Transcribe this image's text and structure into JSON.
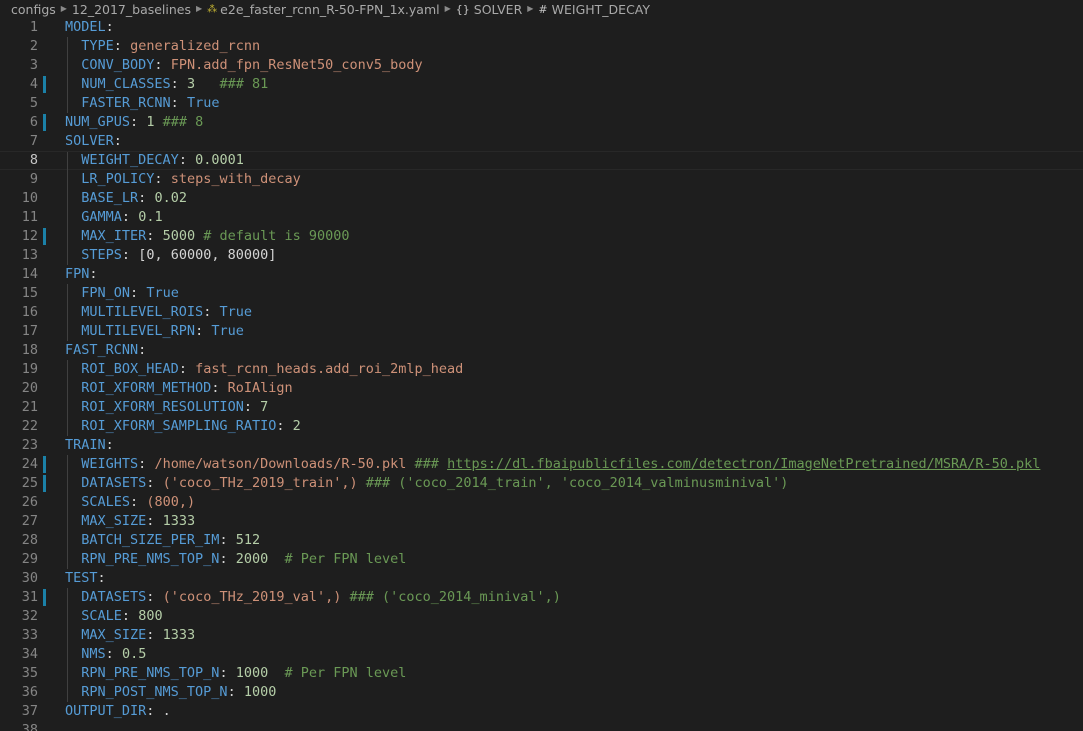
{
  "breadcrumb": {
    "items": [
      "configs",
      "12_2017_baselines",
      "e2e_faster_rcnn_R-50-FPN_1x.yaml",
      "SOLVER",
      "WEIGHT_DECAY"
    ]
  },
  "editor": {
    "current_line": 8,
    "modified_lines": [
      4,
      6,
      12,
      24,
      25,
      31
    ],
    "lines": [
      {
        "n": "1",
        "indent": 0,
        "key": "MODEL",
        "val": "",
        "vt": "",
        "comment": "",
        "extra": ""
      },
      {
        "n": "2",
        "indent": 1,
        "key": "TYPE",
        "val": "generalized_rcnn",
        "vt": "s",
        "comment": "",
        "extra": ""
      },
      {
        "n": "3",
        "indent": 1,
        "key": "CONV_BODY",
        "val": "FPN.add_fpn_ResNet50_conv5_body",
        "vt": "s",
        "comment": "",
        "extra": ""
      },
      {
        "n": "4",
        "indent": 1,
        "key": "NUM_CLASSES",
        "val": "3",
        "vt": "n",
        "comment": "   ### 81",
        "extra": ""
      },
      {
        "n": "5",
        "indent": 1,
        "key": "FASTER_RCNN",
        "val": "True",
        "vt": "b",
        "comment": "",
        "extra": ""
      },
      {
        "n": "6",
        "indent": 0,
        "key": "NUM_GPUS",
        "val": "1",
        "vt": "n",
        "comment": " ### 8",
        "extra": ""
      },
      {
        "n": "7",
        "indent": 0,
        "key": "SOLVER",
        "val": "",
        "vt": "",
        "comment": "",
        "extra": ""
      },
      {
        "n": "8",
        "indent": 1,
        "key": "WEIGHT_DECAY",
        "val": "0.0001",
        "vt": "n",
        "comment": "",
        "extra": ""
      },
      {
        "n": "9",
        "indent": 1,
        "key": "LR_POLICY",
        "val": "steps_with_decay",
        "vt": "s",
        "comment": "",
        "extra": ""
      },
      {
        "n": "10",
        "indent": 1,
        "key": "BASE_LR",
        "val": "0.02",
        "vt": "n",
        "comment": "",
        "extra": ""
      },
      {
        "n": "11",
        "indent": 1,
        "key": "GAMMA",
        "val": "0.1",
        "vt": "n",
        "comment": "",
        "extra": ""
      },
      {
        "n": "12",
        "indent": 1,
        "key": "MAX_ITER",
        "val": "5000",
        "vt": "n",
        "comment": " # default is 90000",
        "extra": ""
      },
      {
        "n": "13",
        "indent": 1,
        "key": "STEPS",
        "val": "[0, 60000, 80000]",
        "vt": "p",
        "comment": "",
        "extra": ""
      },
      {
        "n": "14",
        "indent": 0,
        "key": "FPN",
        "val": "",
        "vt": "",
        "comment": "",
        "extra": ""
      },
      {
        "n": "15",
        "indent": 1,
        "key": "FPN_ON",
        "val": "True",
        "vt": "b",
        "comment": "",
        "extra": ""
      },
      {
        "n": "16",
        "indent": 1,
        "key": "MULTILEVEL_ROIS",
        "val": "True",
        "vt": "b",
        "comment": "",
        "extra": ""
      },
      {
        "n": "17",
        "indent": 1,
        "key": "MULTILEVEL_RPN",
        "val": "True",
        "vt": "b",
        "comment": "",
        "extra": ""
      },
      {
        "n": "18",
        "indent": 0,
        "key": "FAST_RCNN",
        "val": "",
        "vt": "",
        "comment": "",
        "extra": ""
      },
      {
        "n": "19",
        "indent": 1,
        "key": "ROI_BOX_HEAD",
        "val": "fast_rcnn_heads.add_roi_2mlp_head",
        "vt": "s",
        "comment": "",
        "extra": ""
      },
      {
        "n": "20",
        "indent": 1,
        "key": "ROI_XFORM_METHOD",
        "val": "RoIAlign",
        "vt": "s",
        "comment": "",
        "extra": ""
      },
      {
        "n": "21",
        "indent": 1,
        "key": "ROI_XFORM_RESOLUTION",
        "val": "7",
        "vt": "n",
        "comment": "",
        "extra": ""
      },
      {
        "n": "22",
        "indent": 1,
        "key": "ROI_XFORM_SAMPLING_RATIO",
        "val": "2",
        "vt": "n",
        "comment": "",
        "extra": ""
      },
      {
        "n": "23",
        "indent": 0,
        "key": "TRAIN",
        "val": "",
        "vt": "",
        "comment": "",
        "extra": ""
      },
      {
        "n": "24",
        "indent": 1,
        "key": "WEIGHTS",
        "val": "/home/watson/Downloads/R-50.pkl",
        "vt": "s",
        "comment": " ### ",
        "extra": "https://dl.fbaipublicfiles.com/detectron/ImageNetPretrained/MSRA/R-50.pkl"
      },
      {
        "n": "25",
        "indent": 1,
        "key": "DATASETS",
        "val": "('coco_THz_2019_train',)",
        "vt": "s",
        "comment": " ### ('coco_2014_train', 'coco_2014_valminusminival')",
        "extra": ""
      },
      {
        "n": "26",
        "indent": 1,
        "key": "SCALES",
        "val": "(800,)",
        "vt": "s",
        "comment": "",
        "extra": ""
      },
      {
        "n": "27",
        "indent": 1,
        "key": "MAX_SIZE",
        "val": "1333",
        "vt": "n",
        "comment": "",
        "extra": ""
      },
      {
        "n": "28",
        "indent": 1,
        "key": "BATCH_SIZE_PER_IM",
        "val": "512",
        "vt": "n",
        "comment": "",
        "extra": ""
      },
      {
        "n": "29",
        "indent": 1,
        "key": "RPN_PRE_NMS_TOP_N",
        "val": "2000",
        "vt": "n",
        "comment": "  # Per FPN level",
        "extra": ""
      },
      {
        "n": "30",
        "indent": 0,
        "key": "TEST",
        "val": "",
        "vt": "",
        "comment": "",
        "extra": ""
      },
      {
        "n": "31",
        "indent": 1,
        "key": "DATASETS",
        "val": "('coco_THz_2019_val',)",
        "vt": "s",
        "comment": " ### ('coco_2014_minival',)",
        "extra": ""
      },
      {
        "n": "32",
        "indent": 1,
        "key": "SCALE",
        "val": "800",
        "vt": "n",
        "comment": "",
        "extra": ""
      },
      {
        "n": "33",
        "indent": 1,
        "key": "MAX_SIZE",
        "val": "1333",
        "vt": "n",
        "comment": "",
        "extra": ""
      },
      {
        "n": "34",
        "indent": 1,
        "key": "NMS",
        "val": "0.5",
        "vt": "n",
        "comment": "",
        "extra": ""
      },
      {
        "n": "35",
        "indent": 1,
        "key": "RPN_PRE_NMS_TOP_N",
        "val": "1000",
        "vt": "n",
        "comment": "  # Per FPN level",
        "extra": ""
      },
      {
        "n": "36",
        "indent": 1,
        "key": "RPN_POST_NMS_TOP_N",
        "val": "1000",
        "vt": "n",
        "comment": "",
        "extra": ""
      },
      {
        "n": "37",
        "indent": 0,
        "key": "OUTPUT_DIR",
        "val": ".",
        "vt": "p",
        "comment": "",
        "extra": ""
      },
      {
        "n": "38",
        "indent": 0,
        "key": "",
        "val": "",
        "vt": "",
        "comment": "",
        "extra": ""
      }
    ]
  }
}
